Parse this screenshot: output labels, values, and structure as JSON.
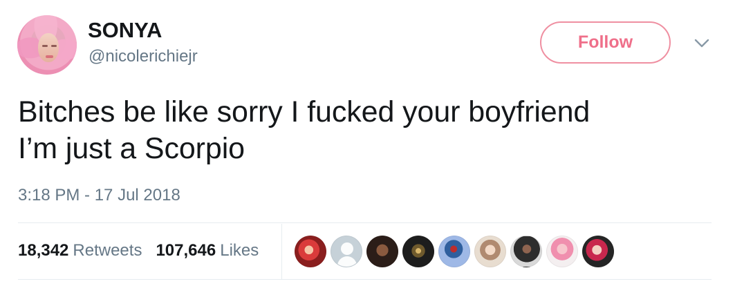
{
  "tweet": {
    "author": {
      "display_name": "SONYA",
      "username": "@nicolerichiejr",
      "avatar_icon": "profile-avatar"
    },
    "follow_button_label": "Follow",
    "caret_icon": "chevron-down-icon",
    "text_lines": [
      "Bitches be like sorry I fucked your boyfriend",
      "I’m just a Scorpio"
    ],
    "timestamp": "3:18 PM - 17 Jul 2018",
    "stats": {
      "retweets": {
        "count": "18,342",
        "label": "Retweets"
      },
      "likes": {
        "count": "107,646",
        "label": "Likes"
      }
    },
    "likers": [
      {
        "icon": "liker-avatar"
      },
      {
        "icon": "default-avatar"
      },
      {
        "icon": "liker-avatar"
      },
      {
        "icon": "liker-avatar"
      },
      {
        "icon": "liker-avatar"
      },
      {
        "icon": "liker-avatar"
      },
      {
        "icon": "liker-avatar"
      },
      {
        "icon": "liker-avatar"
      },
      {
        "icon": "liker-avatar"
      }
    ]
  },
  "colors": {
    "text_primary": "#14171a",
    "text_secondary": "#657786",
    "follow_accent": "#ef6f8a",
    "follow_border": "#ef8fa1",
    "divider": "#e6ecf0"
  }
}
